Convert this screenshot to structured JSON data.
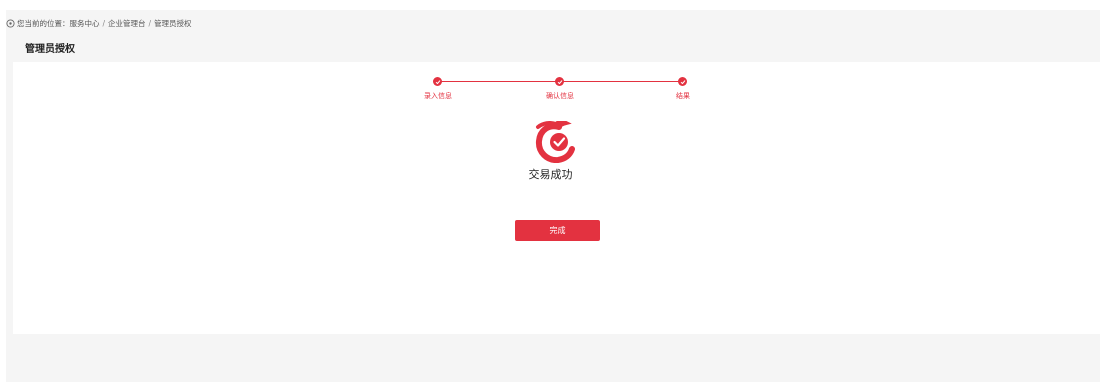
{
  "breadcrumb": {
    "prefix": "您当前的位置：",
    "items": [
      "服务中心",
      "企业管理台",
      "管理员授权"
    ],
    "separator": "/"
  },
  "page": {
    "title": "管理员授权"
  },
  "steps": [
    {
      "label": "录入信息",
      "status": "done"
    },
    {
      "label": "确认信息",
      "status": "done"
    },
    {
      "label": "结果",
      "status": "done"
    }
  ],
  "result": {
    "message": "交易成功",
    "icon": "success-check-icon"
  },
  "actions": {
    "done_label": "完成"
  },
  "colors": {
    "accent": "#e33240",
    "background": "#f5f5f5",
    "card": "#ffffff"
  }
}
